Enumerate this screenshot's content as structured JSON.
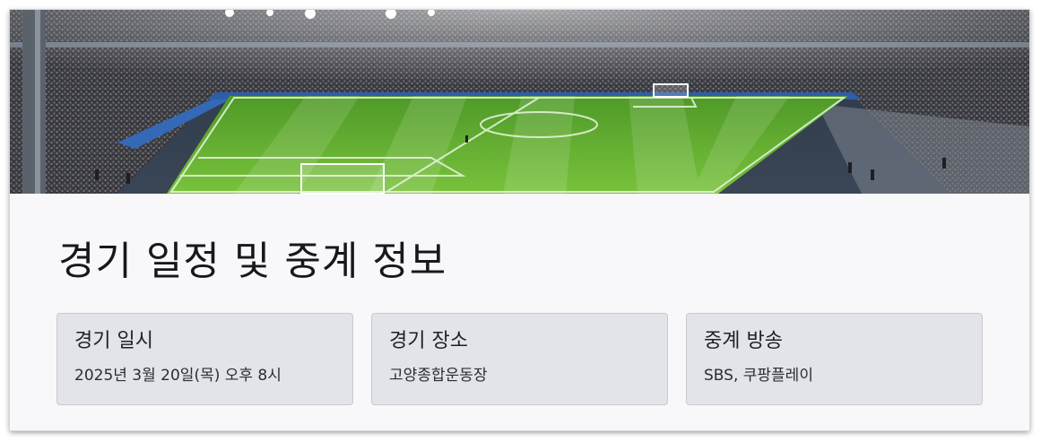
{
  "hero": {
    "image_icon": "stadium-photo"
  },
  "section": {
    "title": "경기 일정 및 중계 정보"
  },
  "cards": [
    {
      "title": "경기 일시",
      "value": "2025년 3월 20일(목) 오후 8시"
    },
    {
      "title": "경기 장소",
      "value": "고양종합운동장"
    },
    {
      "title": "중계 방송",
      "value": "SBS, 쿠팡플레이"
    }
  ],
  "colors": {
    "page_bg": "#f8f8fb",
    "card_bg": "#e3e3ea",
    "card_border": "#c9c9d2",
    "pitch_green": "#5fae2e",
    "text_dark": "#16181d"
  }
}
